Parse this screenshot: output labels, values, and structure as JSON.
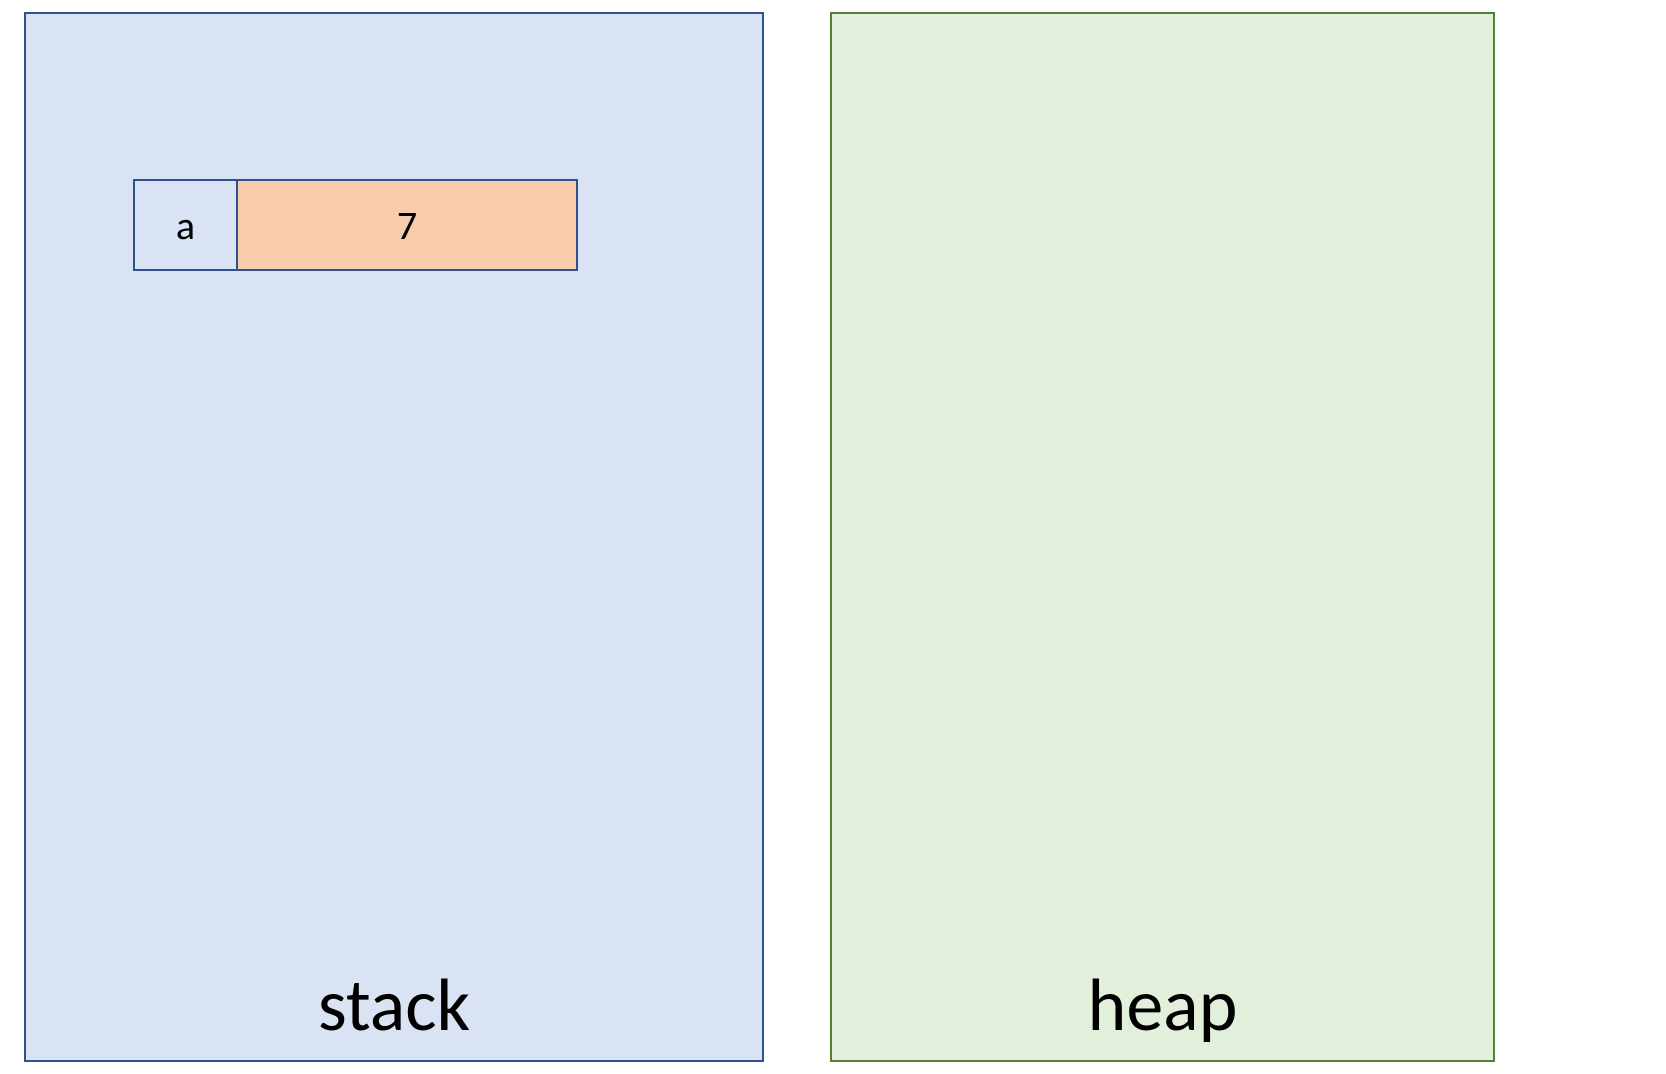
{
  "stack": {
    "label": "stack",
    "variables": [
      {
        "name": "a",
        "value": "7"
      }
    ]
  },
  "heap": {
    "label": "heap"
  },
  "colors": {
    "stack_fill": "#dae3f3",
    "stack_border": "#2f528f",
    "heap_fill": "#e2efda",
    "heap_border": "#548235",
    "value_fill": "#f8cbad"
  }
}
